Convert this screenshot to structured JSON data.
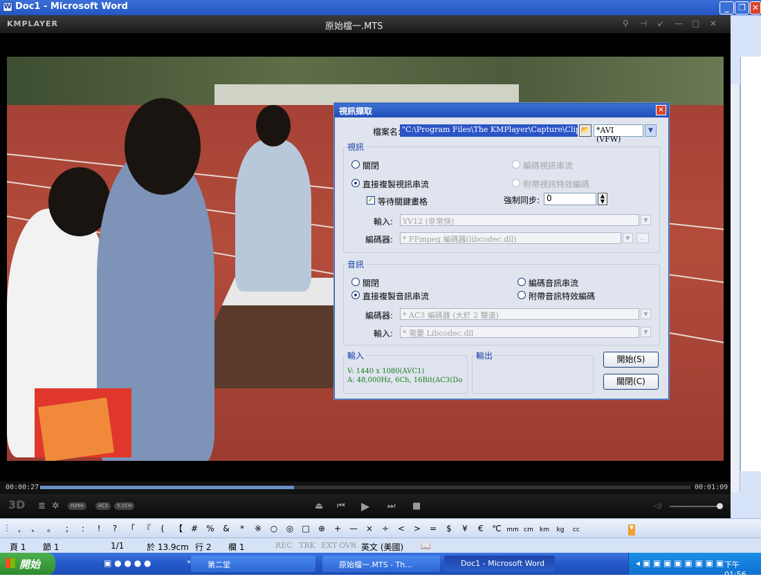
{
  "word": {
    "title": "Doc1 - Microsoft Word",
    "icon_letter": "W"
  },
  "kmplayer": {
    "logo": "KMPLAYER",
    "file_title": "原始檔一.MTS",
    "time_elapsed": "00:00:27",
    "time_total": "00:01:09",
    "progress_fraction": 0.39,
    "controls": {
      "btn_3d": "3D",
      "codec_badges": [
        "H264",
        "AC3",
        "5.1CH"
      ]
    }
  },
  "dialog": {
    "title": "視訊擷取",
    "filename_label": "檔案名:",
    "filename_value": "\"C:\\Program Files\\The KMPlayer\\Capture\\Clip_",
    "format_value": "*AVI (VFW)",
    "video_group": "視訊",
    "video_off": "關閉",
    "video_encode": "編碼視訊串流",
    "video_copy": "直接複製視訊串流",
    "video_filter": "附帶視訊特效編碼",
    "wait_keyframe": "等待關鍵畫格",
    "force_sync_label": "強制同步:",
    "force_sync_value": "0",
    "video_input_label": "輸入:",
    "video_input_value": "YV12 (非常快)",
    "video_encoder_label": "編碼器:",
    "video_encoder_value": "* FFmpeg 編碼器(libcodec.dll)",
    "audio_group": "音訊",
    "audio_off": "關閉",
    "audio_encode": "編碼音訊串流",
    "audio_copy": "直接複製音訊串流",
    "audio_filter": "附帶音訊特效編碼",
    "audio_encoder_label": "編碼器:",
    "audio_encoder_value": "* AC3 編碼器 (大於 2 聲道)",
    "audio_input_label": "輸入:",
    "audio_input_value": "* 需要 Libcodec.dll",
    "input_group": "輸入",
    "input_video": "V: 1440 x 1080(AVC1)",
    "input_audio": "A: 48,000Hz, 6Ch, 16Bit(AC3(Do",
    "output_group": "輸出",
    "start_button": "開始(S)",
    "close_button": "關閉(C)"
  },
  "symbols": [
    ",",
    "、",
    "。",
    ";",
    ":",
    "!",
    "?",
    "「",
    "『",
    "(",
    "【",
    "#",
    "%",
    "&",
    "*",
    "※",
    "○",
    "◎",
    "□",
    "⊕",
    "+",
    "—",
    "×",
    "÷",
    "<",
    ">",
    "=",
    "$",
    "¥",
    "€",
    "℃",
    "mm",
    "cm",
    "km",
    "kg",
    "cc"
  ],
  "status": {
    "page": "頁 1",
    "section": "節 1",
    "pages": "1/1",
    "at": "於 13.9cm",
    "line": "行 2",
    "col": "欄 1",
    "rec": "REC",
    "trk": "TRK",
    "ext": "EXT",
    "ovr": "OVR",
    "lang": "英文 (美國)"
  },
  "taskbar": {
    "start": "開始",
    "folder_task": "第二堂",
    "player_task": "原始檔一.MTS - Th...",
    "word_task": "Doc1 - Microsoft Word",
    "clock": "下午 01:56"
  }
}
